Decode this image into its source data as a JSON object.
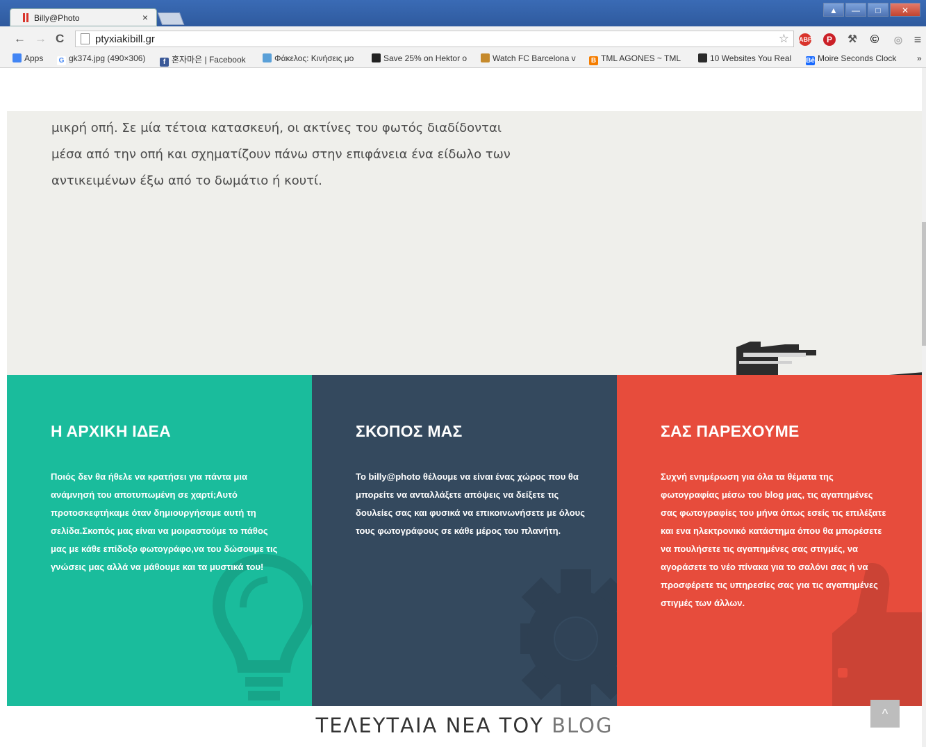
{
  "browser": {
    "tab_title": "Billy@Photo",
    "tab_close": "×",
    "url": "ptyxiakibill.gr",
    "nav": {
      "back": "←",
      "forward": "→",
      "reload": "C"
    },
    "star": "☆",
    "extensions": [
      "abp-icon",
      "pinterest-icon",
      "hammer-icon",
      "copyright-icon",
      "circle-icon",
      "menu-icon"
    ],
    "ext_labels": {
      "abp": "ABP",
      "pinterest": "P",
      "copyright": "©",
      "circle": "◎",
      "menu": "≡",
      "hammer": "⚒"
    },
    "bookmarks": [
      {
        "label": "Apps",
        "icon": "apps-icon"
      },
      {
        "label": "gk374.jpg (490×306)",
        "icon": "google-icon"
      },
      {
        "label": "혼자마은 | Facebook",
        "icon": "facebook-icon"
      },
      {
        "label": "Φάκελος: Κινήσεις μο",
        "icon": "vita-icon"
      },
      {
        "label": "Save 25% on Hektor o",
        "icon": "steam-icon"
      },
      {
        "label": "Watch FC Barcelona v",
        "icon": "barcelona-icon"
      },
      {
        "label": "TML AGONES ~ TML",
        "icon": "blogger-icon"
      },
      {
        "label": "10 Websites You Real",
        "icon": "green-icon"
      },
      {
        "label": "Moire Seconds Clock",
        "icon": "behance-icon"
      }
    ],
    "more": "»"
  },
  "hero": {
    "text_lines": [
      "μικρή οπή. Σε μία τέτοια κατασκευή, οι ακτίνες του φωτός διαδίδονται",
      "μέσα από την οπή και σχηματίζουν πάνω στην επιφάνεια ένα είδωλο των",
      "αντικειμένων έξω από το δωμάτιο ή κουτί."
    ]
  },
  "panels": [
    {
      "title": "Η ΑΡΧΙΚΗ ΙΔΕΑ",
      "text": "Ποιός δεν θα ήθελε να κρατήσει για πάντα μια ανάμνησή του αποτυπωμένη σε χαρτί;Αυτό προτοσκεφτήκαμε όταν δημιουργήσαμε αυτή τη σελίδα.Σκοπός μας είναι να μοιραστούμε το πάθος μας με κάθε επίδοξο φωτογράφο,να του δώσουμε τις γνώσεις μας αλλά να μάθουμε και τα μυστικά του!",
      "color": "#1abc9c",
      "icon": "lightbulb-icon"
    },
    {
      "title": "ΣΚΟΠΟΣ ΜΑΣ",
      "text": "Το billy@photo θέλουμε να είναι ένας χώρος που θα μπορείτε να ανταλλάξετε απόψεις να δείξετε τις δουλείες σας και φυσικά να επικοινωνήσετε με όλους τους φωτογράφους σε κάθε μέρος του πλανήτη.",
      "color": "#34495e",
      "icon": "gear-icon"
    },
    {
      "title": "ΣΑΣ ΠΑΡΕΧΟΥΜΕ",
      "text": "Συχνή ενημέρωση για όλα τα θέματα της φωτογραφίας μέσω του blog μας, τις αγαπημένες σας φωτογραφίες του μήνα όπως εσείς τις επιλέξατε και ενα ηλεκτρονικό κατάστημα όπου θα μπορέσετε να πουλήσετε τις αγαπημένες σας στιγμές, να αγοράσετε το νέο πίνακα για το σαλόνι σας ή να προσφέρετε τις υπηρεσίες σας για τις αγαπημένες στιγμές των άλλων.",
      "color": "#e74c3c",
      "icon": "thumbs-up-icon"
    }
  ],
  "blog": {
    "title_bold": "ΤΕΛΕΥΤΑΙΑ ΝΕΑ ΤΟΥ",
    "title_light": "BLOG"
  },
  "back_to_top": "^"
}
